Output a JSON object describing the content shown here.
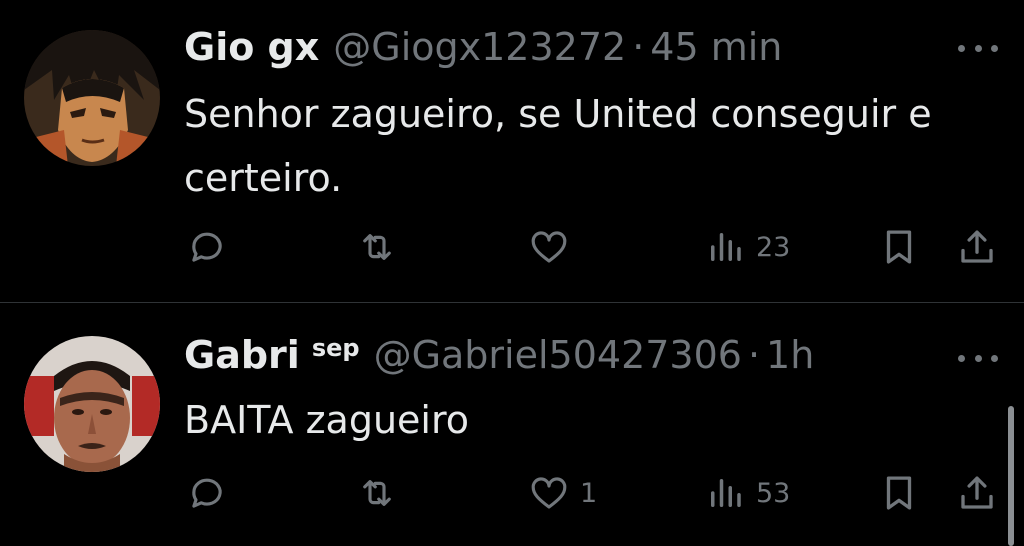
{
  "tweets": [
    {
      "display_name": "Gio gx",
      "name_suffix": "",
      "handle": "@Giogx123272",
      "separator": "·",
      "time": "45 min",
      "text": "Senhor zagueiro, se United conseguir e certeiro.",
      "avatar_icon": "anime-character-avatar",
      "actions": {
        "reply_icon": "reply-icon",
        "retweet_icon": "retweet-icon",
        "like_icon": "heart-icon",
        "like_count": "",
        "views_icon": "views-icon",
        "views_count": "23",
        "bookmark_icon": "bookmark-icon",
        "share_icon": "share-icon"
      }
    },
    {
      "display_name": "Gabri",
      "name_suffix": "sep",
      "handle": "@Gabriel50427306",
      "separator": "·",
      "time": "1h",
      "text": "BAITA zagueiro",
      "avatar_icon": "person-photo-avatar",
      "actions": {
        "reply_icon": "reply-icon",
        "retweet_icon": "retweet-icon",
        "like_icon": "heart-icon",
        "like_count": "1",
        "views_icon": "views-icon",
        "views_count": "53",
        "bookmark_icon": "bookmark-icon",
        "share_icon": "share-icon"
      }
    }
  ],
  "colors": {
    "background": "#000000",
    "primary_text": "#e7e9ea",
    "secondary_text": "#71767b",
    "divider": "#2f3336"
  }
}
